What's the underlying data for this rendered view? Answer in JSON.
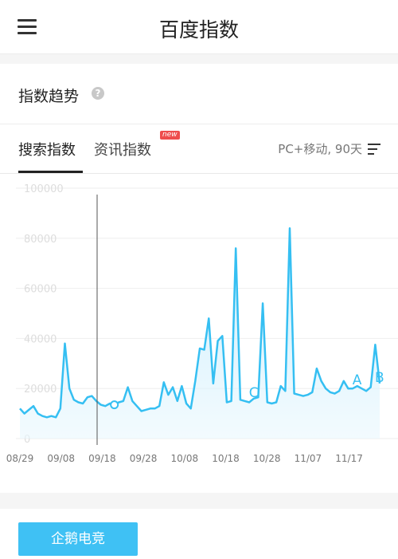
{
  "header": {
    "title": "百度指数"
  },
  "section": {
    "title": "指数趋势",
    "help_glyph": "?"
  },
  "tabs": [
    {
      "label": "搜索指数",
      "active": true
    },
    {
      "label": "资讯指数",
      "active": false,
      "badge": "new"
    }
  ],
  "filter": {
    "label": "PC+移动, 90天"
  },
  "footer": {
    "button_label": "企鹅电竞"
  },
  "colors": {
    "accent": "#3fc1f4",
    "line": "#35bff2",
    "badge": "#ee4d4d"
  },
  "chart_data": {
    "type": "area",
    "title": "",
    "xlabel": "",
    "ylabel": "",
    "ylim": [
      0,
      100000
    ],
    "yticks": [
      "100000",
      "80000",
      "60000",
      "40000",
      "20000",
      "0"
    ],
    "xticks": [
      "08/29",
      "09/08",
      "09/18",
      "09/28",
      "10/08",
      "10/18",
      "10/28",
      "11/07",
      "11/17"
    ],
    "grid": true,
    "cursor_index": 21,
    "series": [
      {
        "values": [
          12000,
          10000,
          11500,
          13000,
          10000,
          9000,
          8500,
          9000,
          8500,
          12000,
          38000,
          20000,
          15500,
          14500,
          14000,
          16500,
          17000,
          15000,
          13500,
          13000,
          14000,
          13500,
          14500,
          15000,
          20500,
          15000,
          13000,
          11000,
          11500,
          12000,
          12000,
          13000,
          22500,
          17500,
          20500,
          15000,
          21000,
          14000,
          12000,
          23000,
          36000,
          35500,
          48000,
          22000,
          39000,
          41000,
          14500,
          15000,
          76000,
          15500,
          15000,
          14500,
          16000,
          16500,
          54000,
          14500,
          14000,
          14500,
          21000,
          19000,
          84000,
          18000,
          17500,
          17000,
          17500,
          18500,
          28000,
          23000,
          20000,
          18500,
          18000,
          19000,
          23000,
          20000,
          20000,
          21000,
          20000,
          19000,
          20500,
          37500,
          22000
        ]
      }
    ],
    "annotations": [
      {
        "label": "C",
        "index": 52
      },
      {
        "label": "A",
        "index": 75
      },
      {
        "label": "B",
        "index": 80
      }
    ]
  }
}
